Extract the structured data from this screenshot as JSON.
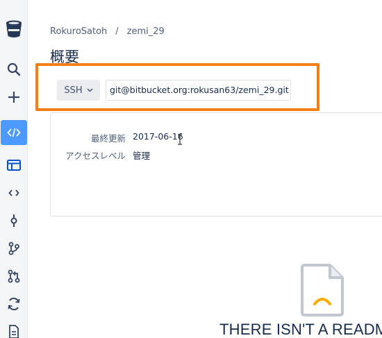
{
  "sidebar": {
    "items": [
      {
        "icon": "bitbucket-logo-icon"
      },
      {
        "icon": "search-icon"
      },
      {
        "icon": "plus-icon"
      },
      {
        "icon": "source-code-icon",
        "active": true
      },
      {
        "icon": "overview-icon"
      },
      {
        "icon": "source-icon"
      },
      {
        "icon": "commits-icon"
      },
      {
        "icon": "branches-icon"
      },
      {
        "icon": "pull-requests-icon"
      },
      {
        "icon": "pipelines-icon"
      },
      {
        "icon": "file-icon"
      }
    ],
    "active_color": "#4c9aff"
  },
  "breadcrumb": {
    "owner": "RokuroSatoh",
    "separator": "/",
    "repo": "zemi_29"
  },
  "page_title": "概要",
  "clone": {
    "protocol": "SSH",
    "url": "git@bitbucket.org:rokusan63/zemi_29.git",
    "highlight_color": "#f57f17"
  },
  "details": {
    "last_updated_label": "最終更新",
    "last_updated_value": "2017-06-16",
    "access_label": "アクセスレベル",
    "access_value": "管理"
  },
  "readme": {
    "icon": "sad-document-icon",
    "message": "THERE ISN'T A README"
  }
}
